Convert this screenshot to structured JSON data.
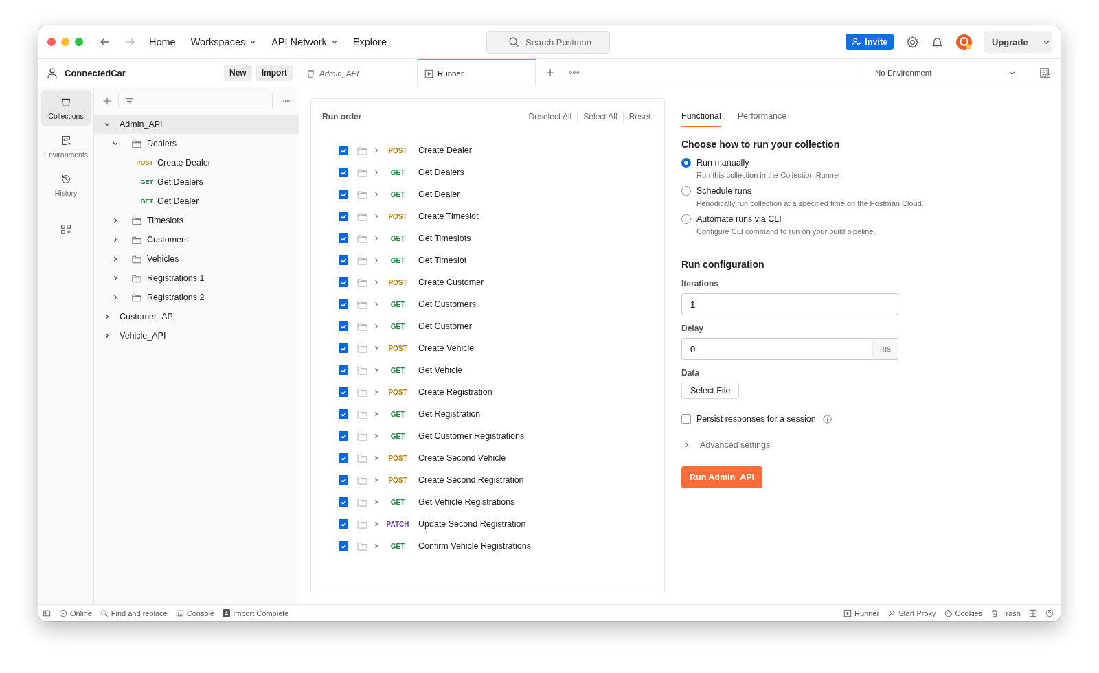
{
  "nav": {
    "items": [
      {
        "label": "Home",
        "dropdown": false
      },
      {
        "label": "Workspaces",
        "dropdown": true
      },
      {
        "label": "API Network",
        "dropdown": true
      },
      {
        "label": "Explore",
        "dropdown": false
      }
    ],
    "search": {
      "placeholder": "Search Postman"
    },
    "invite": "Invite",
    "upgrade": "Upgrade"
  },
  "workspace": {
    "name": "ConnectedCar",
    "buttons": [
      "New",
      "Import"
    ]
  },
  "tabs": [
    {
      "label": "Admin_API",
      "kind": "collection",
      "selected": false
    },
    {
      "label": "Runner",
      "kind": "runner",
      "selected": true
    }
  ],
  "environment": "No Environment",
  "rail": [
    {
      "kind": "collections",
      "label": "Collections",
      "selected": true
    },
    {
      "kind": "environments",
      "label": "Environments",
      "selected": false
    },
    {
      "kind": "history",
      "label": "History",
      "selected": false
    },
    {
      "kind": "apps",
      "selected": false
    }
  ],
  "tree": [
    {
      "kind": "collection",
      "name": "Admin_API",
      "expanded": true,
      "selected": true,
      "children": [
        {
          "kind": "folder",
          "name": "Dealers",
          "expanded": true,
          "selected": false,
          "children": [
            {
              "kind": "request",
              "method": "POST",
              "color": "#b9860d",
              "name": "Create Dealer",
              "selected": false
            },
            {
              "kind": "request",
              "method": "GET",
              "color": "#218a3a",
              "name": "Get Dealers",
              "selected": false
            },
            {
              "kind": "request",
              "method": "GET",
              "color": "#218a3a",
              "name": "Get Dealer",
              "selected": false
            }
          ]
        },
        {
          "kind": "folder",
          "name": "Timeslots",
          "expanded": false,
          "selected": false
        },
        {
          "kind": "folder",
          "name": "Customers",
          "expanded": false,
          "selected": false
        },
        {
          "kind": "folder",
          "name": "Vehicles",
          "expanded": false,
          "selected": false
        },
        {
          "kind": "folder",
          "name": "Registrations 1",
          "expanded": false,
          "selected": false
        },
        {
          "kind": "folder",
          "name": "Registrations 2",
          "expanded": false,
          "selected": false
        }
      ]
    },
    {
      "kind": "collection",
      "name": "Customer_API",
      "expanded": false,
      "selected": false
    },
    {
      "kind": "collection",
      "name": "Vehicle_API",
      "expanded": false,
      "selected": false
    }
  ],
  "run_order": {
    "title": "Run order",
    "actions": [
      "Deselect All",
      "Select All",
      "Reset"
    ],
    "requests": [
      {
        "checked": true,
        "method": "POST",
        "color": "#b9860d",
        "name": "Create Dealer"
      },
      {
        "checked": true,
        "method": "GET",
        "color": "#218a3a",
        "name": "Get Dealers"
      },
      {
        "checked": true,
        "method": "GET",
        "color": "#218a3a",
        "name": "Get Dealer"
      },
      {
        "checked": true,
        "method": "POST",
        "color": "#b9860d",
        "name": "Create Timeslot"
      },
      {
        "checked": true,
        "method": "GET",
        "color": "#218a3a",
        "name": "Get Timeslots"
      },
      {
        "checked": true,
        "method": "GET",
        "color": "#218a3a",
        "name": "Get Timeslot"
      },
      {
        "checked": true,
        "method": "POST",
        "color": "#b9860d",
        "name": "Create Customer"
      },
      {
        "checked": true,
        "method": "GET",
        "color": "#218a3a",
        "name": "Get Customers"
      },
      {
        "checked": true,
        "method": "GET",
        "color": "#218a3a",
        "name": "Get Customer"
      },
      {
        "checked": true,
        "method": "POST",
        "color": "#b9860d",
        "name": "Create Vehicle"
      },
      {
        "checked": true,
        "method": "GET",
        "color": "#218a3a",
        "name": "Get Vehicle"
      },
      {
        "checked": true,
        "method": "POST",
        "color": "#b9860d",
        "name": "Create Registration"
      },
      {
        "checked": true,
        "method": "GET",
        "color": "#218a3a",
        "name": "Get Registration"
      },
      {
        "checked": true,
        "method": "GET",
        "color": "#218a3a",
        "name": "Get Customer Registrations"
      },
      {
        "checked": true,
        "method": "POST",
        "color": "#b9860d",
        "name": "Create Second Vehicle"
      },
      {
        "checked": true,
        "method": "POST",
        "color": "#b9860d",
        "name": "Create Second Registration"
      },
      {
        "checked": true,
        "method": "GET",
        "color": "#218a3a",
        "name": "Get Vehicle Registrations"
      },
      {
        "checked": true,
        "method": "PATCH",
        "color": "#7a3fb0",
        "name": "Update Second Registration"
      },
      {
        "checked": true,
        "method": "GET",
        "color": "#218a3a",
        "name": "Confirm Vehicle Registrations"
      }
    ]
  },
  "run_panel": {
    "tabs": [
      {
        "label": "Functional",
        "selected": true
      },
      {
        "label": "Performance",
        "selected": false
      }
    ],
    "heading": "Choose how to run your collection",
    "options": [
      {
        "label": "Run manually",
        "description": "Run this collection in the Collection Runner.",
        "selected": true
      },
      {
        "label": "Schedule runs",
        "description": "Periodically run collection at a specified time on the Postman Cloud.",
        "selected": false
      },
      {
        "label": "Automate runs via CLI",
        "description": "Configure CLI command to run on your build pipeline.",
        "selected": false
      }
    ],
    "config_heading": "Run configuration",
    "iterations": {
      "label": "Iterations",
      "value": "1"
    },
    "delay": {
      "label": "Delay",
      "value": "0",
      "unit": "ms"
    },
    "data": {
      "label": "Data",
      "button": "Select File"
    },
    "persist": {
      "label": "Persist responses for a session",
      "checked": false
    },
    "advanced": {
      "label": "Advanced settings",
      "expanded": false
    },
    "run_button": "Run Admin_API"
  },
  "status_bar": {
    "left": [
      {
        "kind": "layout"
      },
      {
        "kind": "online",
        "label": "Online"
      },
      {
        "kind": "find",
        "label": "Find and replace"
      },
      {
        "kind": "console",
        "label": "Console"
      },
      {
        "kind": "import",
        "badge": "4",
        "label": "Import Complete"
      }
    ],
    "right": [
      {
        "kind": "runner",
        "label": "Runner"
      },
      {
        "kind": "proxy",
        "label": "Start Proxy"
      },
      {
        "kind": "cookies",
        "label": "Cookies"
      },
      {
        "kind": "trash",
        "label": "Trash"
      },
      {
        "kind": "grid"
      },
      {
        "kind": "help"
      }
    ]
  }
}
